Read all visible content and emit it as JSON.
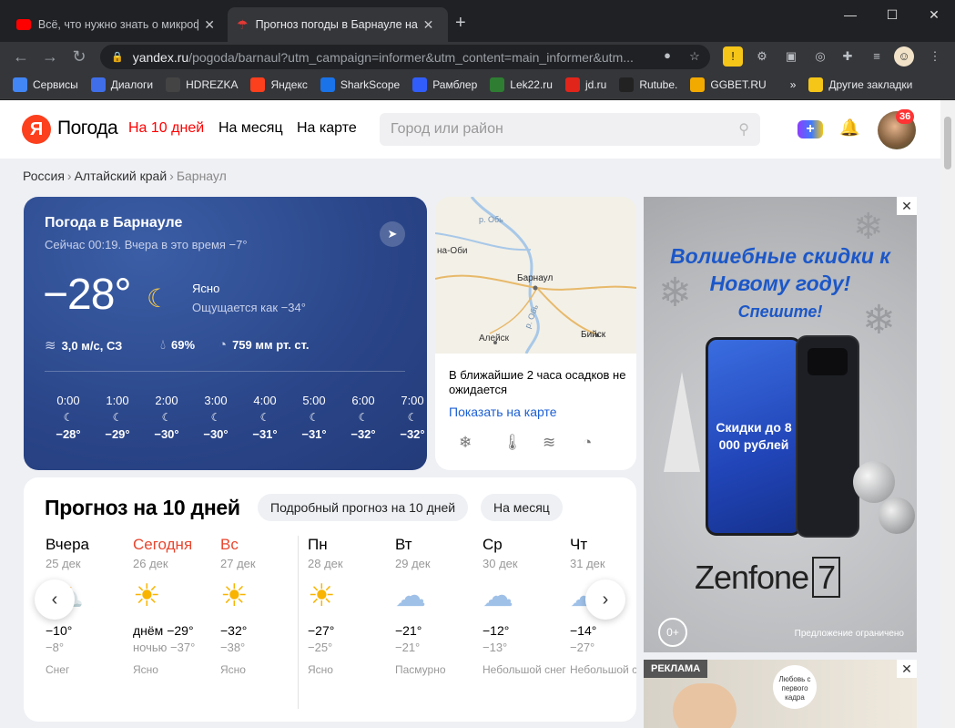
{
  "browser": {
    "tabs": [
      {
        "title": "Всё, что нужно знать о микроф",
        "active": false
      },
      {
        "title": "Прогноз погоды в Барнауле на",
        "active": true
      }
    ],
    "url_host": "yandex.ru",
    "url_path": "/pogoda/barnaul?utm_campaign=informer&utm_content=main_informer&utm...",
    "bookmarks": [
      {
        "label": "Сервисы",
        "icon": "apps-icon",
        "color": "#4285f4"
      },
      {
        "label": "Диалоги",
        "icon": "chat-icon",
        "color": "#3f6ee8"
      },
      {
        "label": "HDREZKA",
        "icon": "hd-icon",
        "color": "#444"
      },
      {
        "label": "Яндекс",
        "icon": "yandex-icon",
        "color": "#fc3f1d"
      },
      {
        "label": "SharkScope",
        "icon": "shark-icon",
        "color": "#1a73e8"
      },
      {
        "label": "Рамблер",
        "icon": "rambler-icon",
        "color": "#315efb"
      },
      {
        "label": "Lek22.ru",
        "icon": "lek-icon",
        "color": "#2e7d32"
      },
      {
        "label": "jd.ru",
        "icon": "jd-icon",
        "color": "#e1251b"
      },
      {
        "label": "Rutube.",
        "icon": "play-icon",
        "color": "#222"
      },
      {
        "label": "GGBET.RU",
        "icon": "gg-icon",
        "color": "#f2a900"
      }
    ],
    "other_bookmarks": "Другие закладки"
  },
  "header": {
    "logo_letter": "Я",
    "logo_text": "Погода",
    "nav": [
      "На 10 дней",
      "На месяц",
      "На карте"
    ],
    "search_placeholder": "Город или район",
    "notifications_badge": "36"
  },
  "breadcrumbs": [
    "Россия",
    "Алтайский край",
    "Барнаул"
  ],
  "current": {
    "title": "Погода в Барнауле",
    "now": "Сейчас 00:19. Вчера в это время −7°",
    "temp": "−28°",
    "condition": "Ясно",
    "feels_like": "Ощущается как −34°",
    "wind": "3,0 м/с, СЗ",
    "humidity": "69%",
    "pressure": "759 мм рт. ст.",
    "hourly": [
      {
        "time": "0:00",
        "temp": "−28°"
      },
      {
        "time": "1:00",
        "temp": "−29°"
      },
      {
        "time": "2:00",
        "temp": "−30°"
      },
      {
        "time": "3:00",
        "temp": "−30°"
      },
      {
        "time": "4:00",
        "temp": "−31°"
      },
      {
        "time": "5:00",
        "temp": "−31°"
      },
      {
        "time": "6:00",
        "temp": "−32°"
      },
      {
        "time": "7:00",
        "temp": "−32°"
      }
    ]
  },
  "map": {
    "labels": [
      "р. Обь",
      "р. Обь",
      "на-Оби",
      "Барнаул",
      "Алейск",
      "Бийск"
    ],
    "message": "В ближайшие 2 часа осадков не ожидается",
    "link": "Показать на карте"
  },
  "forecast": {
    "title": "Прогноз на 10 дней",
    "detail_button": "Подробный прогноз на 10 дней",
    "month_button": "На месяц",
    "days": [
      {
        "name": "Вчера",
        "date": "25 дек",
        "hi": "−10°",
        "lo": "−8°",
        "cond": "Снег",
        "icon": "sun-cloud-snow-icon",
        "red": false
      },
      {
        "name": "Сегодня",
        "date": "26 дек",
        "hi": "днём −29°",
        "lo": "ночью −37°",
        "cond": "Ясно",
        "icon": "sun-icon",
        "red": true
      },
      {
        "name": "Вс",
        "date": "27 дек",
        "hi": "−32°",
        "lo": "−38°",
        "cond": "Ясно",
        "icon": "sun-icon",
        "red": true
      },
      {
        "name": "Пн",
        "date": "28 дек",
        "hi": "−27°",
        "lo": "−25°",
        "cond": "Ясно",
        "icon": "sun-icon",
        "red": false
      },
      {
        "name": "Вт",
        "date": "29 дек",
        "hi": "−21°",
        "lo": "−21°",
        "cond": "Пасмурно",
        "icon": "cloud-icon",
        "red": false
      },
      {
        "name": "Ср",
        "date": "30 дек",
        "hi": "−12°",
        "lo": "−13°",
        "cond": "Небольшой снег",
        "icon": "cloud-snow-icon",
        "red": false
      },
      {
        "name": "Чт",
        "date": "31 дек",
        "hi": "−14°",
        "lo": "−27°",
        "cond": "Небольшой снег",
        "icon": "cloud-snow-icon",
        "red": false
      }
    ]
  },
  "ad": {
    "headline": "Волшебные скидки к Новому году!",
    "sub": "Спешите!",
    "sale": "Скидки до 8 000 рублей",
    "brand": "Zenfone",
    "model": "7",
    "age": "0+",
    "note": "Предложение ограничено"
  },
  "ad2": {
    "label": "РЕКЛАМА",
    "bubble": "Любовь с первого кадра"
  }
}
